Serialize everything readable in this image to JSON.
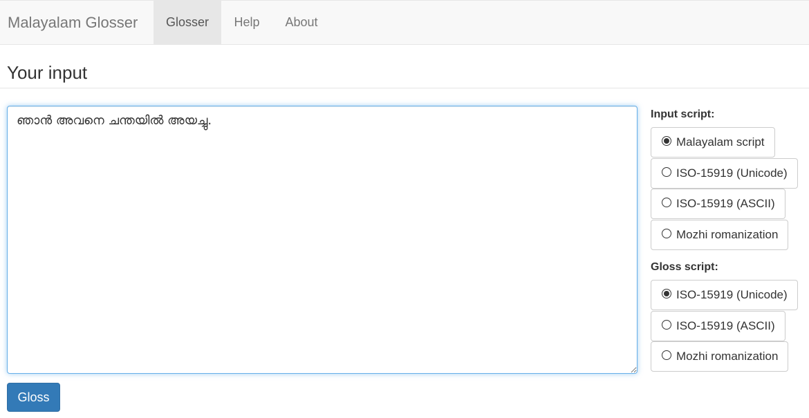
{
  "navbar": {
    "brand": "Malayalam Glosser",
    "items": [
      {
        "label": "Glosser",
        "active": true
      },
      {
        "label": "Help",
        "active": false
      },
      {
        "label": "About",
        "active": false
      }
    ]
  },
  "main": {
    "title": "Your input",
    "input_text": "ഞാൻ അവനെ ചന്തയിൽ അയച്ചു.",
    "gloss_button": "Gloss"
  },
  "input_script": {
    "label": "Input script:",
    "selected": "Malayalam script",
    "options": [
      {
        "label": "Malayalam script",
        "checked": true
      },
      {
        "label": "ISO-15919 (Unicode)",
        "checked": false
      },
      {
        "label": "ISO-15919 (ASCII)",
        "checked": false
      },
      {
        "label": "Mozhi romanization",
        "checked": false
      }
    ]
  },
  "gloss_script": {
    "label": "Gloss script:",
    "selected": "ISO-15919 (Unicode)",
    "options": [
      {
        "label": "ISO-15919 (Unicode)",
        "checked": true
      },
      {
        "label": "ISO-15919 (ASCII)",
        "checked": false
      },
      {
        "label": "Mozhi romanization",
        "checked": false
      }
    ]
  },
  "colors": {
    "primary": "#337ab7",
    "focus_border": "#66afe9",
    "navbar_bg": "#f8f8f8",
    "active_nav_bg": "#e7e7e7"
  }
}
